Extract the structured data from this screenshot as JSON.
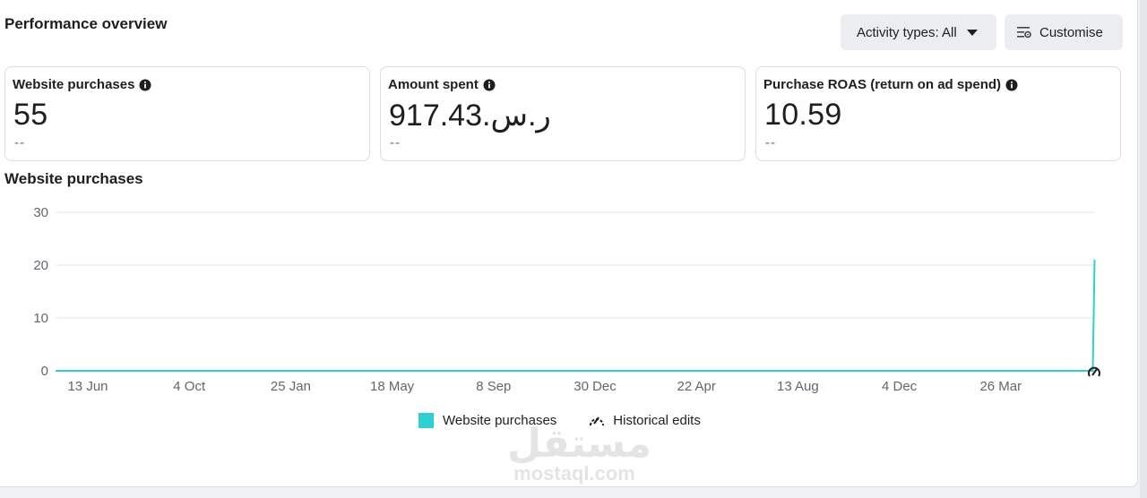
{
  "header": {
    "title": "Performance overview",
    "activity_label": "Activity types: All",
    "customise_label": "Customise"
  },
  "cards": [
    {
      "label": "Website purchases",
      "value": "55",
      "sub": "--"
    },
    {
      "label": "Amount spent",
      "value": "917.43.ر.س",
      "sub": "--"
    },
    {
      "label": "Purchase ROAS (return on ad spend)",
      "value": "10.59",
      "sub": "--"
    }
  ],
  "chart_title": "Website purchases",
  "chart_data": {
    "type": "line",
    "y_ticks": [
      "30",
      "20",
      "10",
      "0"
    ],
    "ylim": [
      0,
      30
    ],
    "x_ticks": [
      "13 Jun",
      "4 Oct",
      "25 Jan",
      "18 May",
      "8 Sep",
      "30 Dec",
      "22 Apr",
      "13 Aug",
      "4 Dec",
      "26 Mar"
    ],
    "series": [
      {
        "name": "Website purchases",
        "color": "#2fcfcf",
        "values": [
          0,
          0,
          0,
          0,
          0,
          0,
          0,
          0,
          0,
          0,
          21
        ]
      }
    ],
    "grid": true,
    "legend_position": "bottom-center"
  },
  "legend": {
    "series_label": "Website purchases",
    "historical_label": "Historical edits"
  },
  "watermark": {
    "arabic": "مستقل",
    "latin": "mostaql.com"
  },
  "colors": {
    "accent": "#2fcfcf",
    "panel": "#ffffff",
    "background": "#f0f2f5"
  }
}
